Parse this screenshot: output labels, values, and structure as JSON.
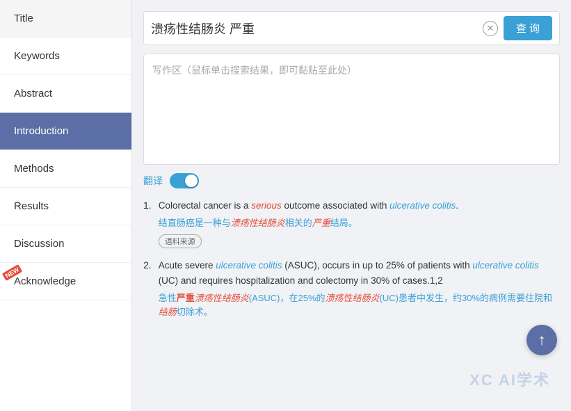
{
  "sidebar": {
    "items": [
      {
        "id": "title",
        "label": "Title",
        "active": false,
        "new": false
      },
      {
        "id": "keywords",
        "label": "Keywords",
        "active": false,
        "new": false
      },
      {
        "id": "abstract",
        "label": "Abstract",
        "active": false,
        "new": false
      },
      {
        "id": "introduction",
        "label": "Introduction",
        "active": true,
        "new": false
      },
      {
        "id": "methods",
        "label": "Methods",
        "active": false,
        "new": false
      },
      {
        "id": "results",
        "label": "Results",
        "active": false,
        "new": false
      },
      {
        "id": "discussion",
        "label": "Discussion",
        "active": false,
        "new": false
      },
      {
        "id": "acknowledge",
        "label": "Acknowledge",
        "active": false,
        "new": true
      }
    ]
  },
  "search": {
    "query": "溃疡性结肠炎 严重",
    "button_label": "查 询",
    "placeholder": "写作区（鼠标单击搜索结果，即可黏贴至此处）"
  },
  "translate": {
    "label": "翻译"
  },
  "results": [
    {
      "number": "1.",
      "en_parts": [
        {
          "text": "Colorectal cancer is a ",
          "style": "normal"
        },
        {
          "text": "serious",
          "style": "red-italic"
        },
        {
          "text": " outcome associated with ",
          "style": "normal"
        },
        {
          "text": "ulcerative colitis",
          "style": "blue-italic"
        },
        {
          "text": ".",
          "style": "normal"
        }
      ],
      "zh": "结直肠癌是一种与溃疡性结肠炎相关的严重结局。",
      "source_tag": "语料来源"
    },
    {
      "number": "2.",
      "en_parts": [
        {
          "text": "Acute severe ",
          "style": "normal"
        },
        {
          "text": "ulcerative colitis",
          "style": "blue-italic"
        },
        {
          "text": " (ASUC), occurs in up to 25% of patients with ",
          "style": "normal"
        },
        {
          "text": "ulcerative colitis",
          "style": "blue-italic"
        },
        {
          "text": " (UC) and requires hospitalization and colectomy in 30% of cases.1,2",
          "style": "normal"
        }
      ],
      "zh": "急性严重溃疡性结肠炎(ASUC)，在25%的溃疡性结肠炎(UC)患者中发生，约30%的病例需要住院和结肠切除术。",
      "source_tag": ""
    }
  ],
  "watermark": "XC AI学术",
  "scroll_up_label": "↑",
  "new_badge_label": "NEW"
}
